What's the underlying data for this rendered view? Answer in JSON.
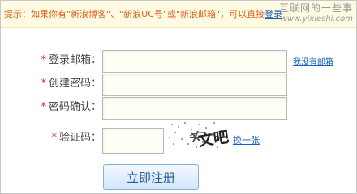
{
  "tip": {
    "text": "提示：如果你有\"新浪博客\"、\"新浪UC号\"或\"新浪邮箱\"，可以直接",
    "link_label": "登录"
  },
  "watermark": {
    "line1": "互联网的一些事",
    "line2": "www.yixieshi.com"
  },
  "form": {
    "required_mark": "*",
    "email_label": "登录邮箱：",
    "password_label": "创建密码：",
    "confirm_label": "密码确认：",
    "captcha_label": "验证码：",
    "email_value": "",
    "password_value": "",
    "confirm_value": "",
    "captcha_value": "",
    "no_email_link": "我没有邮箱",
    "refresh_link": "换一张",
    "captcha_image_text": "文吧"
  },
  "submit_label": "立即注册",
  "colors": {
    "tip_text": "#d9621f",
    "link": "#1a5fb4",
    "required": "#d9302c",
    "tip_background": "#fffbe3"
  }
}
